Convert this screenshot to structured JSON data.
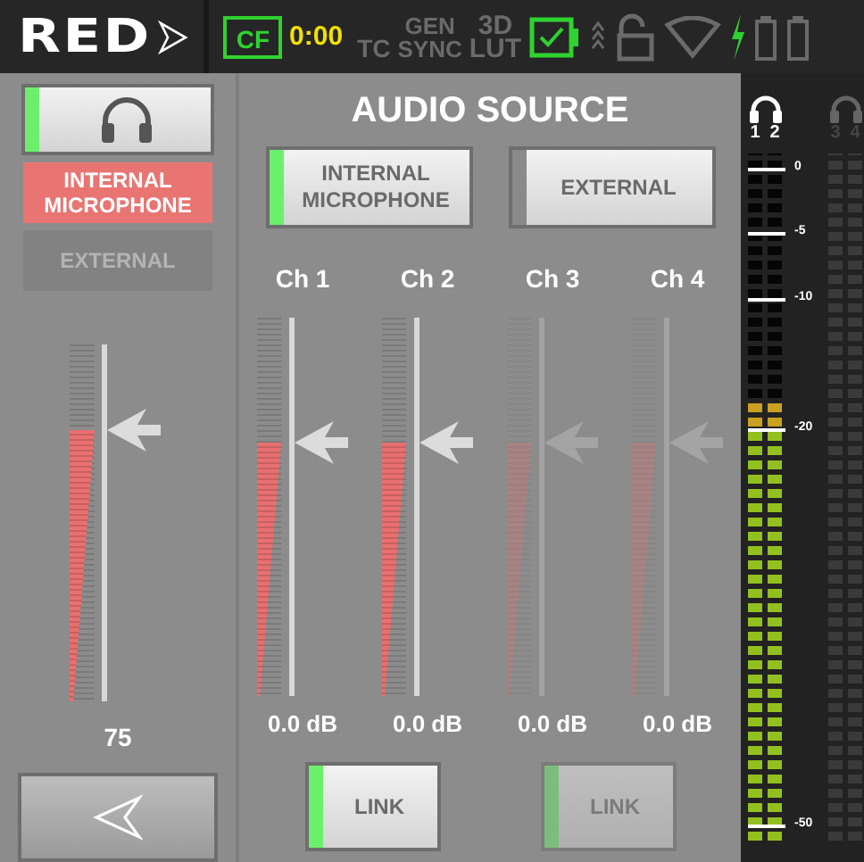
{
  "status_bar": {
    "logo": "RED",
    "media": "CF",
    "timecode": "0:00",
    "tc": "TC",
    "gen_sync": [
      "GEN",
      "SYNC"
    ],
    "lut": [
      "3D",
      "LUT"
    ]
  },
  "monitor": {
    "headphone_on": true,
    "sources": [
      {
        "label": "INTERNAL MICROPHONE",
        "selected": true
      },
      {
        "label": "EXTERNAL",
        "selected": false
      }
    ],
    "level": 0.76,
    "reading": "75"
  },
  "audio_source": {
    "title": "AUDIO SOURCE",
    "options": [
      {
        "label": "INTERNAL MICROPHONE",
        "selected": true
      },
      {
        "label": "EXTERNAL",
        "selected": false
      }
    ],
    "channels": [
      {
        "name": "Ch 1",
        "enabled": true,
        "level": 0.67,
        "reading": "0.0 dB"
      },
      {
        "name": "Ch 2",
        "enabled": true,
        "level": 0.67,
        "reading": "0.0 dB"
      },
      {
        "name": "Ch 3",
        "enabled": false,
        "level": 0.67,
        "reading": "0.0 dB"
      },
      {
        "name": "Ch 4",
        "enabled": false,
        "level": 0.67,
        "reading": "0.0 dB"
      }
    ],
    "links": [
      {
        "label": "LINK",
        "on": true,
        "disabled": false
      },
      {
        "label": "LINK",
        "on": true,
        "disabled": true
      }
    ]
  },
  "meters": {
    "channels": [
      {
        "label": "1",
        "active": true,
        "level": 0.64
      },
      {
        "label": "2",
        "active": true,
        "level": 0.64
      },
      {
        "label": "3",
        "active": false
      },
      {
        "label": "4",
        "active": false
      }
    ],
    "scale": [
      "0",
      "-5",
      "-10",
      "-20",
      "-50"
    ]
  }
}
